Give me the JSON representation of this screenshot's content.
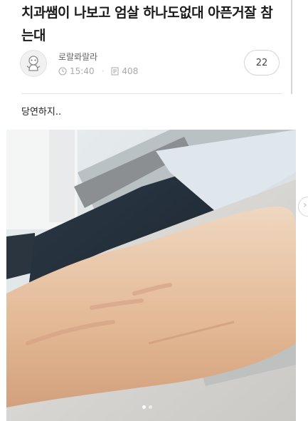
{
  "post": {
    "title": "치과쌤이 나보고 엄살 하나도없대 아픈거잘 참는대",
    "author": "로랄롸랄라",
    "time": "15:40",
    "views": "408",
    "comment_count": "22",
    "body": "당연하지.."
  },
  "carousel": {
    "total": 2,
    "active_index": 0
  },
  "icons": {
    "avatar": "profile-avatar-icon",
    "time": "clock-icon",
    "views": "document-icon",
    "next": "chevron-right-icon"
  }
}
